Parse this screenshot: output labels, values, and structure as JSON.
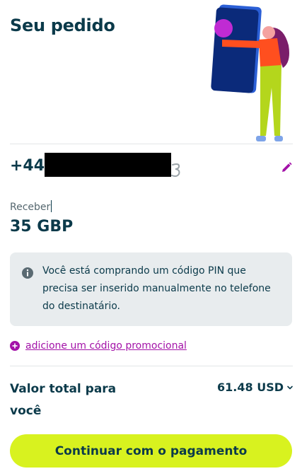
{
  "header": {
    "title": "Seu pedido"
  },
  "recipient": {
    "country_code": "+44",
    "operator_logo_icon": "three-logo-icon",
    "edit_icon": "pencil-icon"
  },
  "receive": {
    "label": "Receber",
    "amount": "35 GBP"
  },
  "info": {
    "icon": "info-icon",
    "text": "Você está comprando um código PIN que precisa ser inserido manualmente no telefone do destinatário."
  },
  "promo": {
    "icon": "plus-circle-icon",
    "label": "adicione um código promocional"
  },
  "total": {
    "label": "Valor total para você",
    "value": "61.48 USD",
    "icon": "chevron-down-icon"
  },
  "cta": {
    "label": "Continuar com o pagamento"
  },
  "colors": {
    "primary_text": "#0b3a4a",
    "accent": "#a312a8",
    "cta_background": "#d8f21f",
    "info_background": "#e8ecee"
  }
}
